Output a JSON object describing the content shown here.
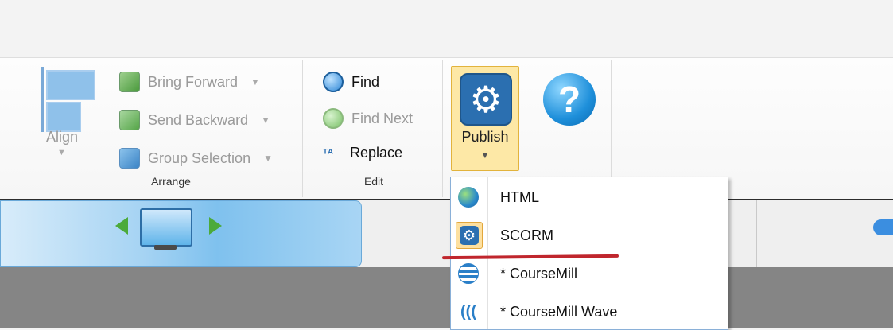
{
  "ribbon": {
    "arrange": {
      "align_label": "Align",
      "bring_forward": "Bring Forward",
      "send_backward": "Send Backward",
      "group_selection": "Group Selection",
      "group_label": "Arrange"
    },
    "edit": {
      "find": "Find",
      "find_next": "Find Next",
      "replace": "Replace",
      "group_label": "Edit"
    },
    "publish": {
      "label": "Publish"
    }
  },
  "publish_menu": {
    "items": [
      {
        "label": "HTML",
        "icon": "globe-icon"
      },
      {
        "label": "SCORM",
        "icon": "gear-icon"
      },
      {
        "label": "* CourseMill",
        "icon": "coursemill-icon"
      },
      {
        "label": "* CourseMill Wave",
        "icon": "wave-icon"
      }
    ]
  },
  "colors": {
    "publish_highlight": "#fde8a6",
    "accent_blue": "#2b6fb0",
    "underline_red": "#c0262d",
    "nav_green": "#4caa3a"
  }
}
